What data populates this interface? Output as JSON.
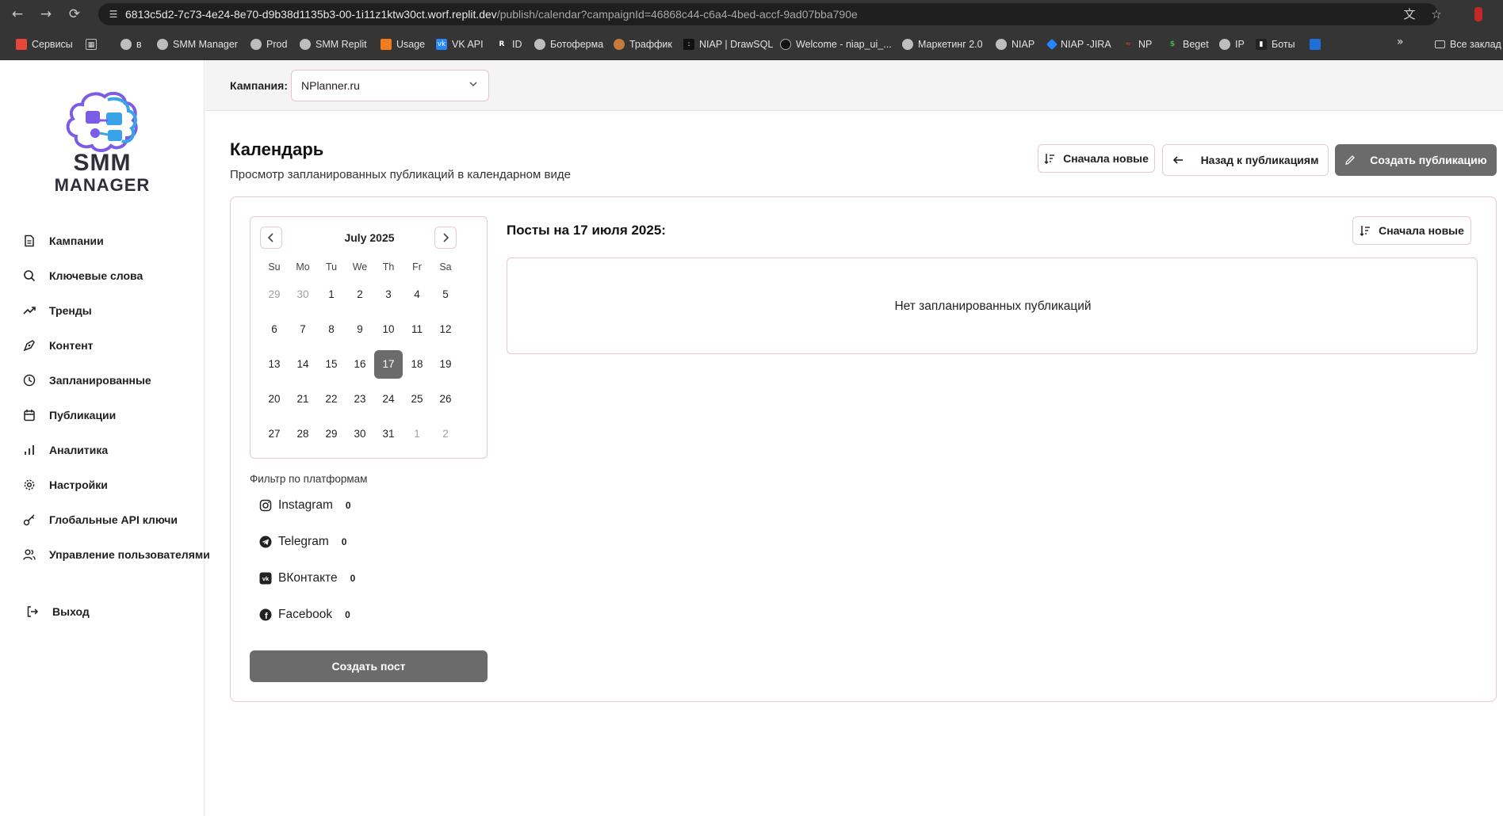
{
  "browser": {
    "url_main": "6813c5d2-7c73-4e24-8e70-d9b38d1135b3-00-1i11z1ktw30ct.worf.replit.dev",
    "url_path": "/publish/calendar?campaignId=46868c44-c6a4-4bed-accf-9ad07bba790e",
    "bookmarks": [
      "Сервисы",
      "в",
      "SMM Manager",
      "Prod",
      "SMM Replit",
      "Usage",
      "VK API",
      "ID",
      "Ботоферма",
      "Траффик",
      "NIAP | DrawSQL",
      "Welcome - niap_ui_...",
      "Маркетинг 2.0",
      "NIAP",
      "NIAP -JIRA",
      "NP",
      "Beget",
      "IP",
      "Боты"
    ],
    "all_bookmarks": "Все заклад"
  },
  "logo": {
    "line1": "SMM",
    "line2": "MANAGER"
  },
  "sidebar": {
    "items": [
      {
        "label": "Кампании",
        "icon": "document-icon"
      },
      {
        "label": "Ключевые слова",
        "icon": "search-icon"
      },
      {
        "label": "Тренды",
        "icon": "trending-up-icon"
      },
      {
        "label": "Контент",
        "icon": "pen-tool-icon"
      },
      {
        "label": "Запланированные",
        "icon": "clock-icon"
      },
      {
        "label": "Публикации",
        "icon": "calendar-icon"
      },
      {
        "label": "Аналитика",
        "icon": "bar-chart-icon"
      },
      {
        "label": "Настройки",
        "icon": "gear-icon"
      },
      {
        "label": "Глобальные API ключи",
        "icon": "key-icon"
      },
      {
        "label": "Управление пользователями",
        "icon": "users-icon"
      }
    ],
    "logout": "Выход"
  },
  "topbar": {
    "campaign_label": "Кампания:",
    "campaign_value": "NPlanner.ru"
  },
  "header": {
    "title": "Календарь",
    "subtitle": "Просмотр запланированных публикаций в календарном виде",
    "sort_label": "Сначала новые",
    "back_label": "Назад к публикациям",
    "create_label": "Создать публикацию"
  },
  "calendar": {
    "month": "July 2025",
    "dow": [
      "Su",
      "Mo",
      "Tu",
      "We",
      "Th",
      "Fr",
      "Sa"
    ],
    "weeks": [
      [
        "29",
        "30",
        "1",
        "2",
        "3",
        "4",
        "5"
      ],
      [
        "6",
        "7",
        "8",
        "9",
        "10",
        "11",
        "12"
      ],
      [
        "13",
        "14",
        "15",
        "16",
        "17",
        "18",
        "19"
      ],
      [
        "20",
        "21",
        "22",
        "23",
        "24",
        "25",
        "26"
      ],
      [
        "27",
        "28",
        "29",
        "30",
        "31",
        "1",
        "2"
      ]
    ],
    "selected_day": "17"
  },
  "filters": {
    "title": "Фильтр по платформам",
    "platforms": [
      {
        "name": "Instagram",
        "count": "0"
      },
      {
        "name": "Telegram",
        "count": "0"
      },
      {
        "name": "ВКонтакте",
        "count": "0"
      },
      {
        "name": "Facebook",
        "count": "0"
      }
    ],
    "create_post": "Создать пост"
  },
  "posts": {
    "title": "Посты на 17 июля 2025:",
    "sort_label": "Сначала новые",
    "empty": "Нет запланированных публикаций"
  },
  "colors": {
    "accent_dark": "#6b6b6b",
    "border_pink": "#e8c7ce",
    "logo_purple": "#7b5ce6",
    "logo_blue": "#3aa3e8"
  }
}
